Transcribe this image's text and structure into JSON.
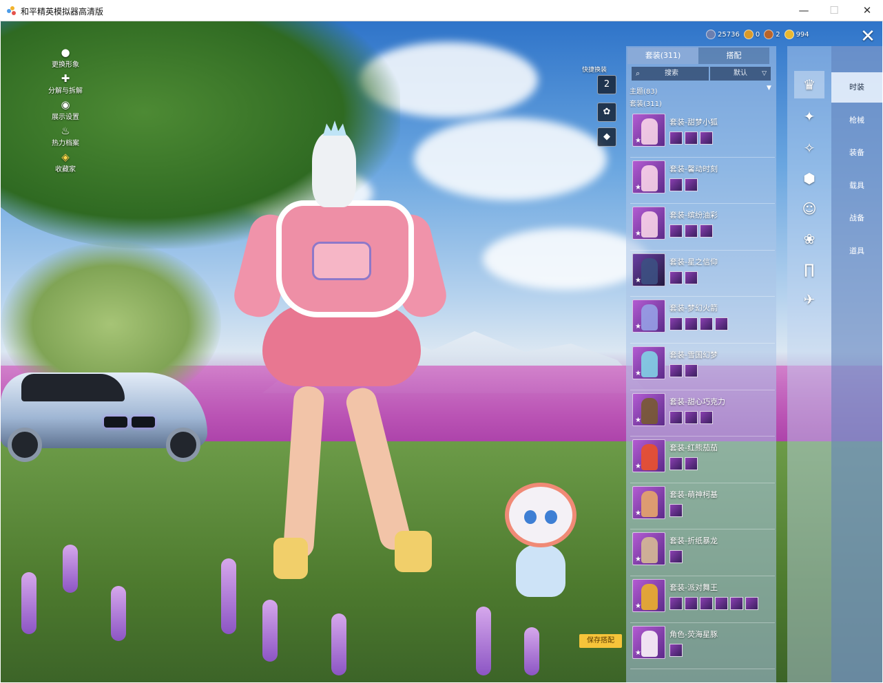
{
  "window": {
    "title": "和平精英模拟器高清版",
    "minimize": "—",
    "maximize": "☐",
    "close": "✕"
  },
  "left_menu": [
    {
      "label": "更换形象",
      "icon": "person-icon"
    },
    {
      "label": "分解与拆解",
      "icon": "puzzle-icon"
    },
    {
      "label": "展示设置",
      "icon": "eye-icon"
    },
    {
      "label": "热力档案",
      "icon": "flame-icon"
    },
    {
      "label": "收藏家",
      "icon": "collector-badge-icon"
    }
  ],
  "currency": [
    {
      "value": "25736",
      "icon": "globe-coin-icon",
      "color": "#6b7fb0"
    },
    {
      "value": "0",
      "icon": "a-token-icon",
      "color": "#d89a2b"
    },
    {
      "value": "2",
      "icon": "bronze-coin-icon",
      "color": "#b8642b"
    },
    {
      "value": "994",
      "icon": "gold-coin-icon",
      "color": "#e9b830"
    }
  ],
  "quick_swap": {
    "label": "快捷换装",
    "buttons": [
      {
        "text": "2",
        "icon": "hanger-icon"
      },
      {
        "text": "",
        "icon": "emblem-icon"
      },
      {
        "text": "",
        "icon": "diamond-badge-icon"
      }
    ]
  },
  "panel": {
    "tabs": [
      "套装(311)",
      "搭配"
    ],
    "active_tab": 0,
    "search_label": "搜索",
    "sort_label": "默认",
    "section_theme": "主题(83)",
    "section_suits": "套装(311)",
    "outfits": [
      {
        "name": "套装-甜梦小狐"
      },
      {
        "name": "套装-馨动时刻"
      },
      {
        "name": "套装-缤纷油彩"
      },
      {
        "name": "套装-星之信仰"
      },
      {
        "name": "套装-梦幻火箭"
      },
      {
        "name": "套装-雪国幻梦"
      },
      {
        "name": "套装-甜心巧克力"
      },
      {
        "name": "套装-红熊茄茄"
      },
      {
        "name": "套装-萌神柯基"
      },
      {
        "name": "套装-折纸暴龙"
      },
      {
        "name": "套装-派对舞王"
      },
      {
        "name": "角色-荧海星豚"
      }
    ]
  },
  "save_button": "保存搭配",
  "category_icons": [
    "outfit-icon",
    "gun-icon",
    "gear-icon",
    "vehicle-icon",
    "mask-icon",
    "pet-icon",
    "pants-icon",
    "glider-icon"
  ],
  "right_tabs": [
    "时装",
    "枪械",
    "装备",
    "载具",
    "战备",
    "道具"
  ],
  "active_right_tab": 0
}
